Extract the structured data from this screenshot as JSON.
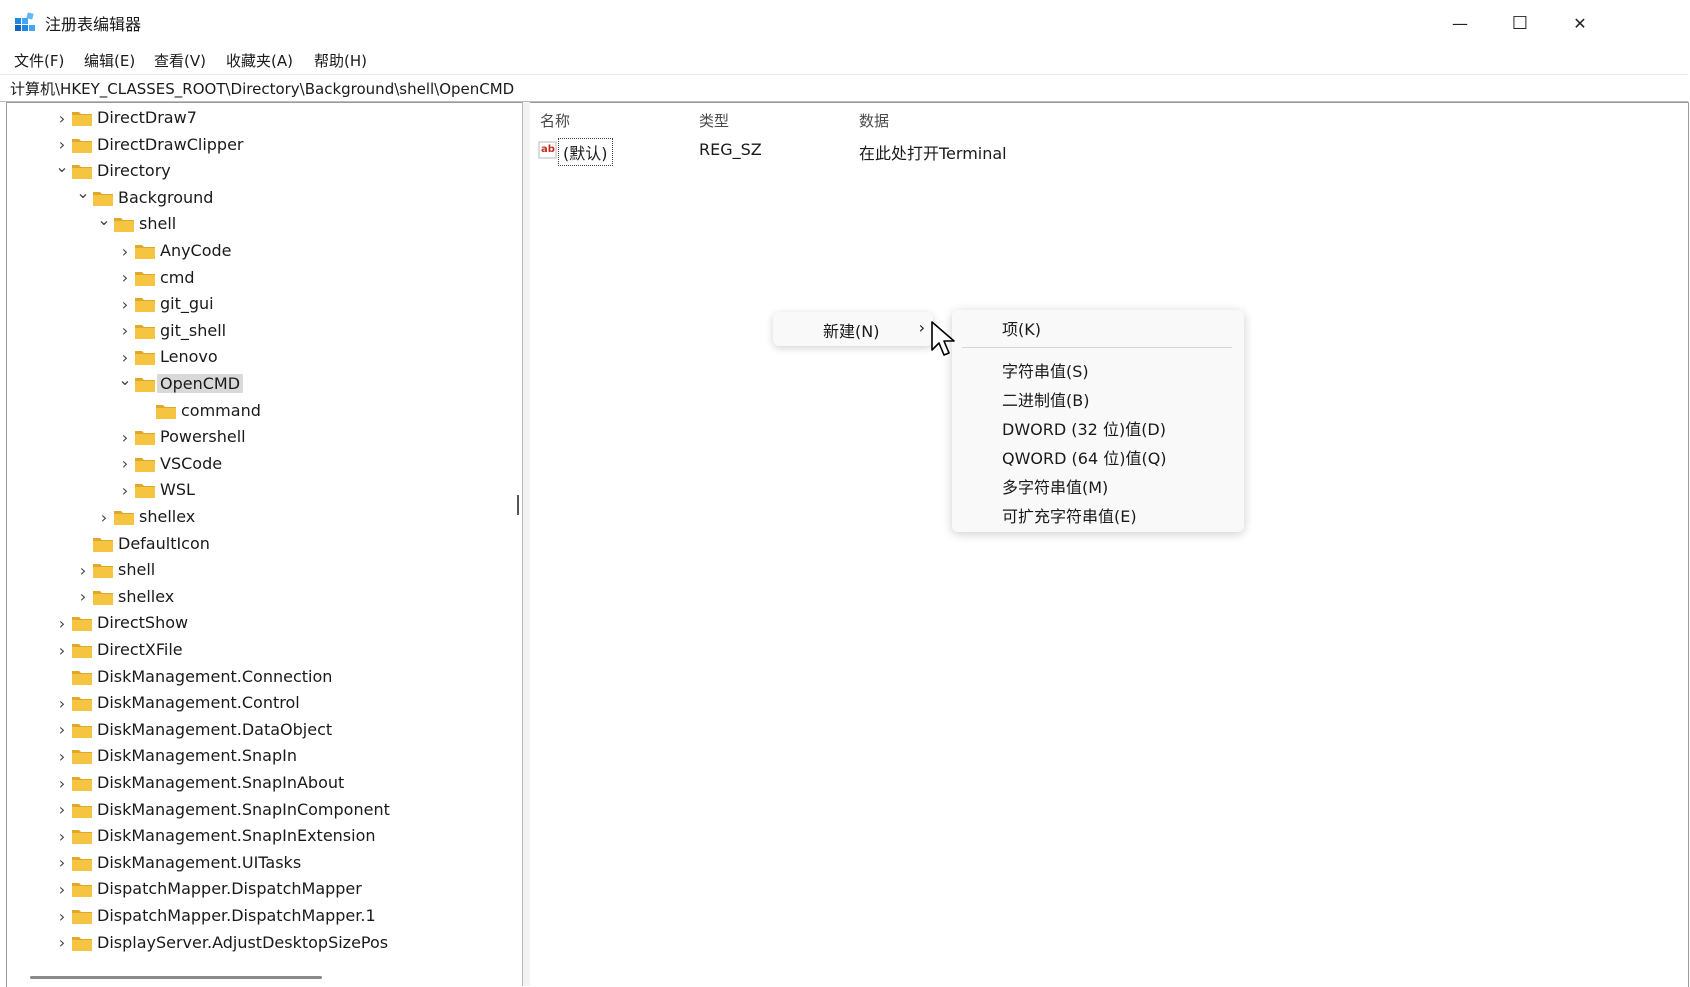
{
  "window": {
    "title": "注册表编辑器"
  },
  "controls": {
    "minimize": "—",
    "maximize": "☐",
    "close": "✕"
  },
  "menu": [
    "文件(F)",
    "编辑(E)",
    "查看(V)",
    "收藏夹(A)",
    "帮助(H)"
  ],
  "address": "计算机\\HKEY_CLASSES_ROOT\\Directory\\Background\\shell\\OpenCMD",
  "tree": [
    {
      "label": "DirectDraw7",
      "level": 0,
      "toggle": "collapsed"
    },
    {
      "label": "DirectDrawClipper",
      "level": 0,
      "toggle": "collapsed"
    },
    {
      "label": "Directory",
      "level": 0,
      "toggle": "expanded"
    },
    {
      "label": "Background",
      "level": 1,
      "toggle": "expanded"
    },
    {
      "label": "shell",
      "level": 2,
      "toggle": "expanded"
    },
    {
      "label": "AnyCode",
      "level": 3,
      "toggle": "collapsed"
    },
    {
      "label": "cmd",
      "level": 3,
      "toggle": "collapsed"
    },
    {
      "label": "git_gui",
      "level": 3,
      "toggle": "collapsed"
    },
    {
      "label": "git_shell",
      "level": 3,
      "toggle": "collapsed"
    },
    {
      "label": "Lenovo",
      "level": 3,
      "toggle": "collapsed"
    },
    {
      "label": "OpenCMD",
      "level": 3,
      "toggle": "expanded",
      "selected": true
    },
    {
      "label": "command",
      "level": 4,
      "toggle": "none"
    },
    {
      "label": "Powershell",
      "level": 3,
      "toggle": "collapsed"
    },
    {
      "label": "VSCode",
      "level": 3,
      "toggle": "collapsed"
    },
    {
      "label": "WSL",
      "level": 3,
      "toggle": "collapsed"
    },
    {
      "label": "shellex",
      "level": 2,
      "toggle": "collapsed"
    },
    {
      "label": "DefaultIcon",
      "level": 1,
      "toggle": "none"
    },
    {
      "label": "shell",
      "level": 1,
      "toggle": "collapsed"
    },
    {
      "label": "shellex",
      "level": 1,
      "toggle": "collapsed"
    },
    {
      "label": "DirectShow",
      "level": 0,
      "toggle": "collapsed"
    },
    {
      "label": "DirectXFile",
      "level": 0,
      "toggle": "collapsed"
    },
    {
      "label": "DiskManagement.Connection",
      "level": 0,
      "toggle": "none"
    },
    {
      "label": "DiskManagement.Control",
      "level": 0,
      "toggle": "collapsed"
    },
    {
      "label": "DiskManagement.DataObject",
      "level": 0,
      "toggle": "collapsed"
    },
    {
      "label": "DiskManagement.SnapIn",
      "level": 0,
      "toggle": "collapsed"
    },
    {
      "label": "DiskManagement.SnapInAbout",
      "level": 0,
      "toggle": "collapsed"
    },
    {
      "label": "DiskManagement.SnapInComponent",
      "level": 0,
      "toggle": "collapsed"
    },
    {
      "label": "DiskManagement.SnapInExtension",
      "level": 0,
      "toggle": "collapsed"
    },
    {
      "label": "DiskManagement.UITasks",
      "level": 0,
      "toggle": "collapsed"
    },
    {
      "label": "DispatchMapper.DispatchMapper",
      "level": 0,
      "toggle": "collapsed"
    },
    {
      "label": "DispatchMapper.DispatchMapper.1",
      "level": 0,
      "toggle": "collapsed"
    },
    {
      "label": "DisplayServer.AdjustDesktopSizePos",
      "level": 0,
      "toggle": "collapsed"
    }
  ],
  "list": {
    "headers": {
      "name": "名称",
      "type": "类型",
      "data": "数据"
    },
    "rows": [
      {
        "icon": "ab-string-icon",
        "name": "(默认)",
        "type": "REG_SZ",
        "data": "在此处打开Terminal"
      }
    ]
  },
  "context_menu": {
    "new_label": "新建(N)",
    "arrow": "›",
    "submenu": {
      "key": "项(K)",
      "items": [
        "字符串值(S)",
        "二进制值(B)",
        "DWORD (32 位)值(D)",
        "QWORD (64 位)值(Q)",
        "多字符串值(M)",
        "可扩充字符串值(E)"
      ]
    }
  },
  "colors": {
    "folder": "#f5c542",
    "folder_dark": "#e0a82a",
    "accent": "#0067c0",
    "ab_red": "#c42b1c"
  }
}
